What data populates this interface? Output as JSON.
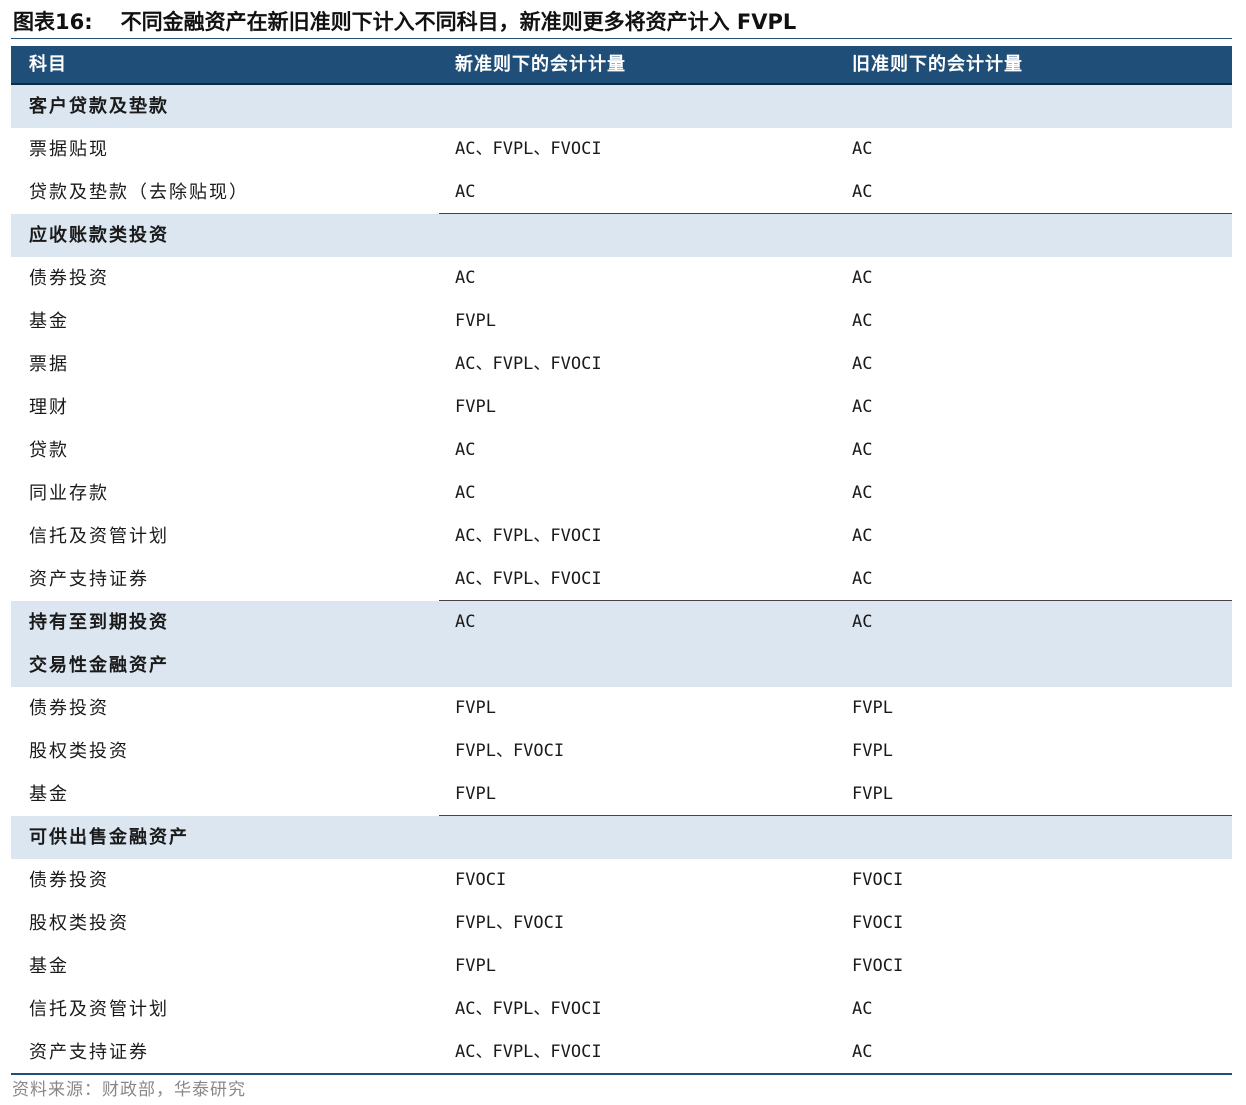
{
  "title": {
    "fig_no": "图表16:",
    "text": "不同金融资产在新旧准则下计入不同科目，新准则更多将资产计入 FVPL"
  },
  "table": {
    "headers": [
      "科目",
      "新准则下的会计计量",
      "旧准则下的会计计量"
    ],
    "rows": [
      {
        "type": "section",
        "cells": [
          "客户贷款及垫款",
          "",
          ""
        ]
      },
      {
        "type": "item",
        "cells": [
          "票据贴现",
          "AC、FVPL、FVOCI",
          "AC"
        ]
      },
      {
        "type": "item",
        "cells": [
          "贷款及垫款（去除贴现）",
          "AC",
          "AC"
        ]
      },
      {
        "type": "section",
        "cells": [
          "应收账款类投资",
          "",
          ""
        ]
      },
      {
        "type": "item",
        "cells": [
          "债券投资",
          "AC",
          "AC"
        ]
      },
      {
        "type": "item",
        "cells": [
          "基金",
          "FVPL",
          "AC"
        ]
      },
      {
        "type": "item",
        "cells": [
          "票据",
          "AC、FVPL、FVOCI",
          "AC"
        ]
      },
      {
        "type": "item",
        "cells": [
          "理财",
          "FVPL",
          "AC"
        ]
      },
      {
        "type": "item",
        "cells": [
          "贷款",
          "AC",
          "AC"
        ]
      },
      {
        "type": "item",
        "cells": [
          "同业存款",
          "AC",
          "AC"
        ]
      },
      {
        "type": "item",
        "cells": [
          "信托及资管计划",
          "AC、FVPL、FVOCI",
          "AC"
        ]
      },
      {
        "type": "item",
        "cells": [
          "资产支持证券",
          "AC、FVPL、FVOCI",
          "AC"
        ]
      },
      {
        "type": "section",
        "cells": [
          "持有至到期投资",
          "AC",
          "AC"
        ]
      },
      {
        "type": "section",
        "cells": [
          "交易性金融资产",
          "",
          ""
        ]
      },
      {
        "type": "item",
        "cells": [
          "债券投资",
          "FVPL",
          "FVPL"
        ]
      },
      {
        "type": "item",
        "cells": [
          "股权类投资",
          "FVPL、FVOCI",
          "FVPL"
        ]
      },
      {
        "type": "item",
        "cells": [
          "基金",
          "FVPL",
          "FVPL"
        ]
      },
      {
        "type": "section",
        "cells": [
          "可供出售金融资产",
          "",
          ""
        ]
      },
      {
        "type": "item",
        "cells": [
          "债券投资",
          "FVOCI",
          "FVOCI"
        ]
      },
      {
        "type": "item",
        "cells": [
          "股权类投资",
          "FVPL、FVOCI",
          "FVOCI"
        ]
      },
      {
        "type": "item",
        "cells": [
          "基金",
          "FVPL",
          "FVOCI"
        ]
      },
      {
        "type": "item",
        "cells": [
          "信托及资管计划",
          "AC、FVPL、FVOCI",
          "AC"
        ]
      },
      {
        "type": "item",
        "cells": [
          "资产支持证券",
          "AC、FVPL、FVOCI",
          "AC"
        ]
      }
    ]
  },
  "source": "资料来源：财政部，华泰研究",
  "colors": {
    "header_bg": "#1f4e79",
    "section_bg": "#dce6f1",
    "header_text": "#ffffff"
  }
}
